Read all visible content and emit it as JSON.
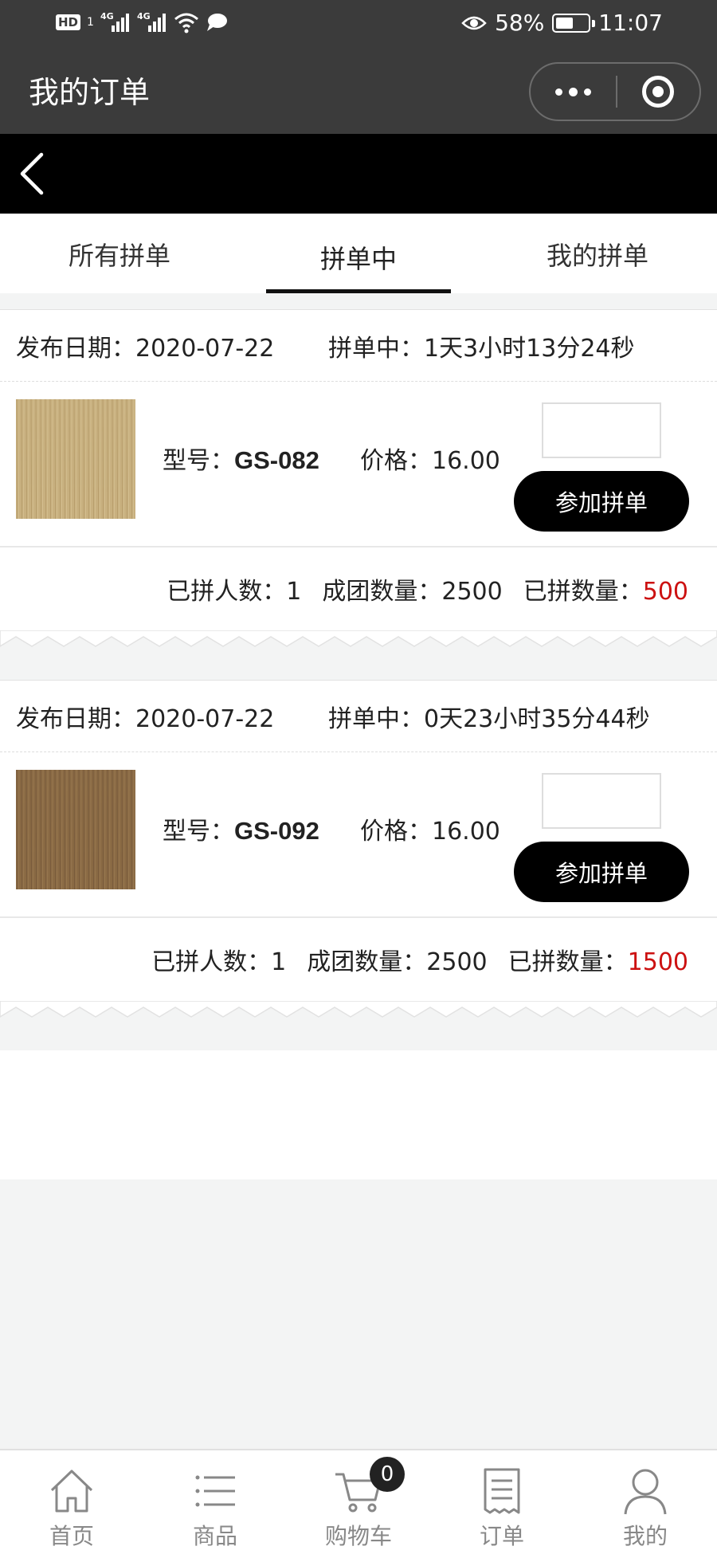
{
  "status": {
    "hd_label": "HD",
    "hd_num": "1",
    "network1": "4G",
    "network2": "4G",
    "battery_pct_text": "58%",
    "battery_level": 0.58,
    "time": "11:07"
  },
  "header": {
    "title": "我的订单"
  },
  "tabs": [
    {
      "label": "所有拼单",
      "active": false
    },
    {
      "label": "拼单中",
      "active": true
    },
    {
      "label": "我的拼单",
      "active": false
    }
  ],
  "orders": [
    {
      "publish_text": "发布日期：2020-07-22",
      "countdown_text": "拼单中：1天3小时13分24秒",
      "model_label": "型号：",
      "model": "GS-082",
      "price_text": "价格：16.00",
      "join_label": "参加拼单",
      "swatch_color": "#c8b07f",
      "joined_people_text": "已拼人数：1",
      "group_qty_text": "成团数量：2500",
      "joined_qty_label": "已拼数量：",
      "joined_qty": "500"
    },
    {
      "publish_text": "发布日期：2020-07-22",
      "countdown_text": "拼单中：0天23小时35分44秒",
      "model_label": "型号：",
      "model": "GS-092",
      "price_text": "价格：16.00",
      "join_label": "参加拼单",
      "swatch_color": "#8a6a44",
      "joined_people_text": "已拼人数：1",
      "group_qty_text": "成团数量：2500",
      "joined_qty_label": "已拼数量：",
      "joined_qty": "1500"
    }
  ],
  "tabbar": {
    "items": [
      {
        "label": "首页",
        "icon": "home-icon"
      },
      {
        "label": "商品",
        "icon": "list-icon"
      },
      {
        "label": "购物车",
        "icon": "cart-icon",
        "badge": "0"
      },
      {
        "label": "订单",
        "icon": "receipt-icon"
      },
      {
        "label": "我的",
        "icon": "user-icon"
      }
    ]
  },
  "colors": {
    "header_bg": "#3b3b3b",
    "accent_red": "#cc1111",
    "button_bg": "#000000"
  }
}
